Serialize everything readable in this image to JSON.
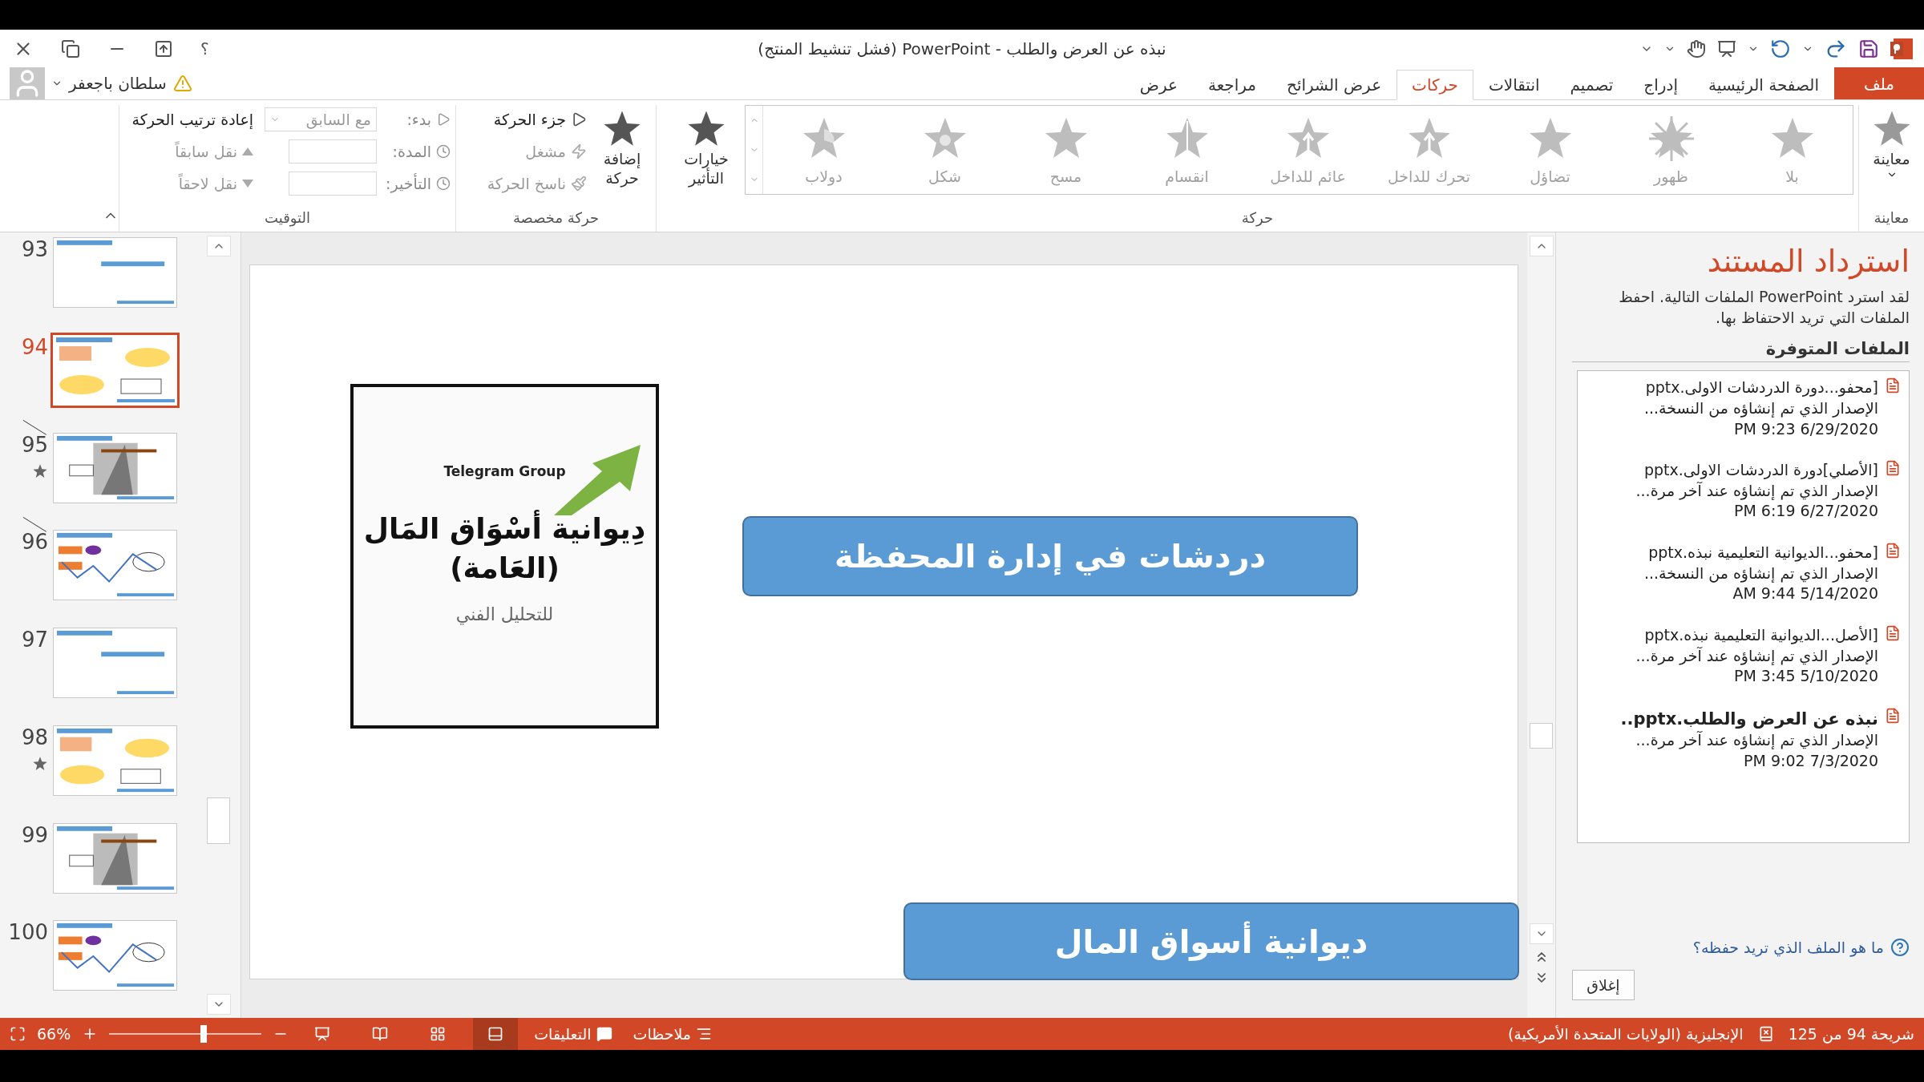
{
  "window": {
    "title": "نبذه عن العرض والطلب - PowerPoint (فشل تنشيط المنتج)",
    "help": "؟"
  },
  "user": {
    "name": "سلطان باجعفر"
  },
  "tabs": [
    {
      "label": "ملف",
      "kind": "file",
      "selected": false
    },
    {
      "label": "الصفحة الرئيسية",
      "kind": "tab",
      "selected": false
    },
    {
      "label": "إدراج",
      "kind": "tab",
      "selected": false
    },
    {
      "label": "تصميم",
      "kind": "tab",
      "selected": false
    },
    {
      "label": "انتقالات",
      "kind": "tab",
      "selected": false
    },
    {
      "label": "حركات",
      "kind": "tab",
      "selected": true
    },
    {
      "label": "عرض الشرائح",
      "kind": "tab",
      "selected": false
    },
    {
      "label": "مراجعة",
      "kind": "tab",
      "selected": false
    },
    {
      "label": "عرض",
      "kind": "tab",
      "selected": false
    }
  ],
  "ribbon": {
    "preview": {
      "label": "معاينة",
      "group_label": "معاينة"
    },
    "animation": {
      "group_label": "حركة",
      "effect_options": {
        "label": "خيارات التأثير",
        "disabled": false
      },
      "gallery": [
        {
          "label": "بلا",
          "kind": "plain",
          "disabled": true
        },
        {
          "label": "ظهور",
          "kind": "burst",
          "disabled": true
        },
        {
          "label": "تضاؤل",
          "kind": "plain",
          "disabled": true
        },
        {
          "label": "تحرك للداخل",
          "kind": "fly",
          "disabled": true
        },
        {
          "label": "عائم للداخل",
          "kind": "float",
          "disabled": true
        },
        {
          "label": "انقسام",
          "kind": "split",
          "disabled": true
        },
        {
          "label": "مسح",
          "kind": "plain",
          "disabled": true
        },
        {
          "label": "شكل",
          "kind": "shape",
          "disabled": true
        },
        {
          "label": "دولاب",
          "kind": "wheel",
          "disabled": true
        }
      ]
    },
    "advanced": {
      "group_label": "حركة مخصصة",
      "add_animation": {
        "label": "إضافة حركة",
        "disabled": false
      },
      "commands": [
        {
          "label": "جزء الحركة",
          "kind": "pane",
          "disabled": false
        },
        {
          "label": "مشغل",
          "kind": "trigger",
          "disabled": true
        },
        {
          "label": "ناسخ الحركة",
          "kind": "painter",
          "disabled": true
        }
      ]
    },
    "timing": {
      "group_label": "التوقيت",
      "start": {
        "label": "بدء:",
        "value": "مع السابق"
      },
      "duration": {
        "label": "المدة:"
      },
      "delay": {
        "label": "التأخير:"
      },
      "reorder_title": "إعادة ترتيب الحركة",
      "reorder": [
        {
          "label": "نقل سابقاً",
          "kind": "up",
          "disabled": true
        },
        {
          "label": "نقل لاحقاً",
          "kind": "down",
          "disabled": true
        }
      ]
    }
  },
  "slides": [
    {
      "number": "93",
      "selected": false,
      "animated": false,
      "hidden": false
    },
    {
      "number": "94",
      "selected": true,
      "animated": false,
      "hidden": false
    },
    {
      "number": "95",
      "selected": false,
      "animated": true,
      "hidden": true
    },
    {
      "number": "96",
      "selected": false,
      "animated": false,
      "hidden": true
    },
    {
      "number": "97",
      "selected": false,
      "animated": false,
      "hidden": false
    },
    {
      "number": "98",
      "selected": false,
      "animated": true,
      "hidden": false
    },
    {
      "number": "99",
      "selected": false,
      "animated": false,
      "hidden": false
    },
    {
      "number": "100",
      "selected": false,
      "animated": false,
      "hidden": false
    }
  ],
  "slide": {
    "image": {
      "caption": "Telegram Group",
      "title_lines": [
        "دِيوانية أسْوَاق المَال",
        "(العَامة)"
      ],
      "subtitle": "للتحليل الفني"
    },
    "boxes": [
      {
        "text": "دردشات في إدارة المحفظة"
      },
      {
        "text": "ديوانية أسواق المال"
      }
    ]
  },
  "recovery": {
    "title": "استرداد المستند",
    "description": "لقد استرد PowerPoint الملفات التالية. احفظ الملفات التي تريد الاحتفاظ بها.",
    "files_heading": "الملفات المتوفرة",
    "files": [
      {
        "name": "[محفو...دورة الدردشات الاولى.pptx",
        "note": "الإصدار الذي تم إنشاؤه من النسخة...",
        "time": "PM 9:23 6/29/2020",
        "current": false
      },
      {
        "name": "[الأصلي]دورة الدردشات الاولى.pptx",
        "note": "الإصدار الذي تم إنشاؤه عند آخر مرة...",
        "time": "PM 6:19 6/27/2020",
        "current": false
      },
      {
        "name": "[محفو...الديوانية التعليمية نبذه.pptx",
        "note": "الإصدار الذي تم إنشاؤه من النسخة...",
        "time": "AM 9:44 5/14/2020",
        "current": false
      },
      {
        "name": "[الأصل...الديوانية التعليمية نبذه.pptx",
        "note": "الإصدار الذي تم إنشاؤه عند آخر مرة...",
        "time": "PM 3:45 5/10/2020",
        "current": false
      },
      {
        "name": "نبذه عن العرض والطلب.pptx..",
        "note": "الإصدار الذي تم إنشاؤه عند آخر مرة...",
        "time": "PM 9:02 7/3/2020",
        "current": true
      }
    ],
    "help_link": "ما هو الملف الذي تريد حفظه؟",
    "close": "إغلاق"
  },
  "status_bar": {
    "slide_position": "شريحة 94 من 125",
    "language": "الإنجليزية (الولايات المتحدة الأمريكية)",
    "notes": "ملاحظات",
    "comments": "التعليقات",
    "zoom": "66%",
    "zoom_slider": {
      "level": 0.62
    },
    "views": [
      {
        "kind": "slideshow",
        "selected": false
      },
      {
        "kind": "reading",
        "selected": false
      },
      {
        "kind": "sorter",
        "selected": false
      },
      {
        "kind": "normal",
        "selected": true
      }
    ]
  }
}
